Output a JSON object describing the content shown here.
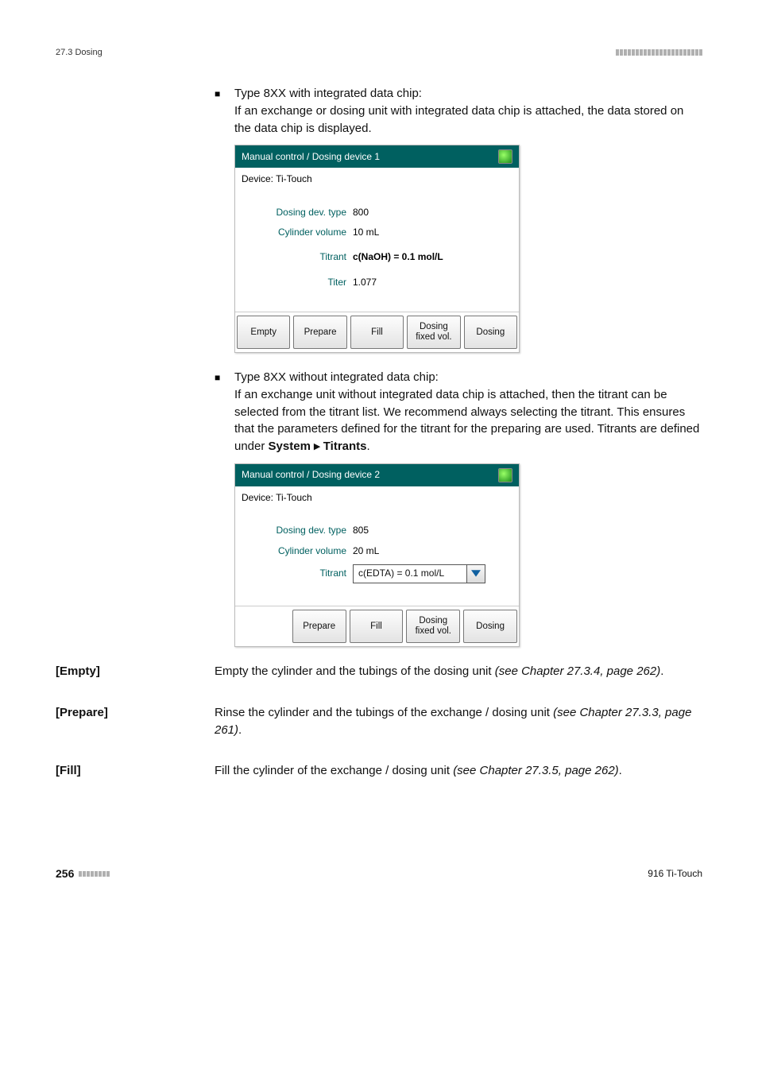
{
  "header": {
    "left": "27.3 Dosing"
  },
  "bullet1": {
    "title": "Type 8XX with integrated data chip:",
    "text": "If an exchange or dosing unit with integrated data chip is attached, the data stored on the data chip is displayed."
  },
  "shot1": {
    "title": "Manual control / Dosing device 1",
    "device": "Device: Ti-Touch",
    "rows": {
      "dev_label": "Dosing dev. type",
      "dev_val": "800",
      "cyl_label": "Cylinder volume",
      "cyl_val": "10 mL",
      "titrant_label": "Titrant",
      "titrant_val": "c(NaOH) = 0.1 mol/L",
      "titer_label": "Titer",
      "titer_val": "1.077"
    },
    "buttons": {
      "empty": "Empty",
      "prepare": "Prepare",
      "fill": "Fill",
      "fixed": "Dosing\nfixed vol.",
      "dosing": "Dosing"
    }
  },
  "bullet2": {
    "title": "Type 8XX without integrated data chip:",
    "text_a": "If an exchange unit without integrated data chip is attached, then the titrant can be selected from the titrant list. We recommend always selecting the titrant. This ensures that the parameters defined for the titrant for the preparing are used. Titrants are defined under ",
    "text_b_bold": "System ▸ Titrants",
    "text_c": "."
  },
  "shot2": {
    "title": "Manual control / Dosing device 2",
    "device": "Device: Ti-Touch",
    "rows": {
      "dev_label": "Dosing dev. type",
      "dev_val": "805",
      "cyl_label": "Cylinder volume",
      "cyl_val": "20 mL",
      "titrant_label": "Titrant",
      "titrant_val": "c(EDTA) = 0.1 mol/L"
    },
    "buttons": {
      "prepare": "Prepare",
      "fill": "Fill",
      "fixed": "Dosing\nfixed vol.",
      "dosing": "Dosing"
    }
  },
  "defs": {
    "empty": {
      "term": "[Empty]",
      "text": "Empty the cylinder and the tubings of the dosing unit ",
      "ref": "(see Chapter 27.3.4, page 262)",
      "tail": "."
    },
    "prepare": {
      "term": "[Prepare]",
      "text": "Rinse the cylinder and the tubings of the exchange / dosing unit ",
      "ref": "(see Chapter 27.3.3, page 261)",
      "tail": "."
    },
    "fill": {
      "term": "[Fill]",
      "text": "Fill the cylinder of the exchange / dosing unit ",
      "ref": "(see Chapter 27.3.5, page 262)",
      "tail": "."
    }
  },
  "footer": {
    "page": "256",
    "product": "916 Ti-Touch"
  }
}
